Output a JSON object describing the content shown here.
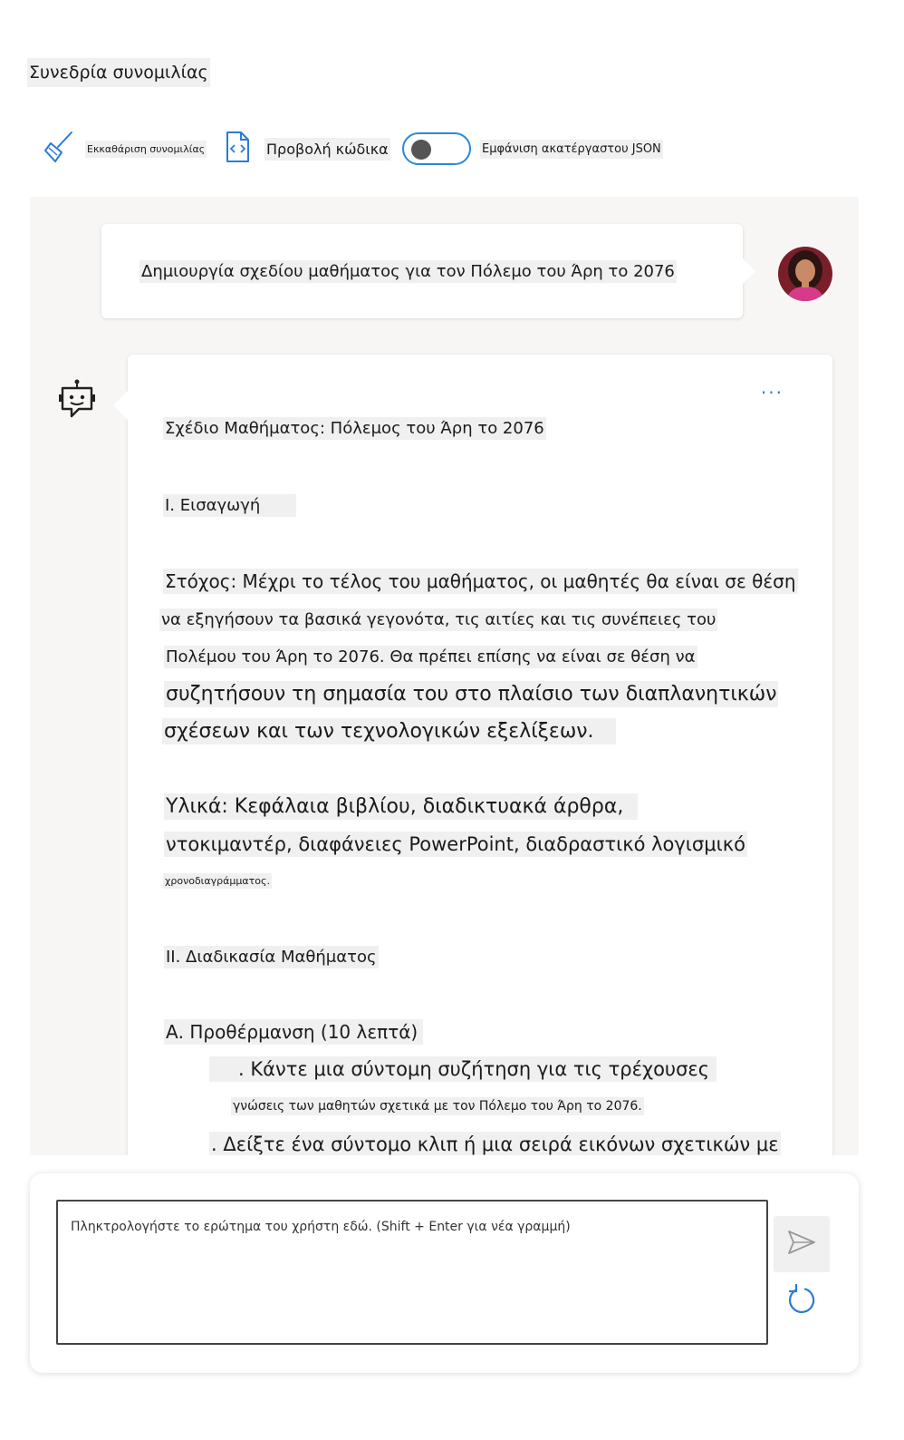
{
  "page_title": "Συνεδρία συνομιλίας",
  "toolbar": {
    "clear_label": "Εκκαθάριση συνομιλίας",
    "code_label": "Προβολή κώδικα",
    "raw_json_label": "Εμφάνιση ακατέργαστου JSON",
    "raw_json_enabled": false
  },
  "conversation": {
    "user_message": "Δημιουργία σχεδίου μαθήματος για τον Πόλεμο του Άρη το 2076",
    "assistant_lines": [
      "Σχέδιο Μαθήματος: Πόλεμος του Άρη το 2076",
      "I. Εισαγωγή",
      "Στόχος: Μέχρι το τέλος του μαθήματος, οι μαθητές θα είναι σε θέση",
      "να εξηγήσουν τα βασικά γεγονότα, τις αιτίες και τις συνέπειες του",
      "Πολέμου του Άρη το 2076. Θα πρέπει επίσης να είναι σε θέση να",
      "συζητήσουν τη σημασία του στο πλαίσιο των διαπλανητικών",
      "σχέσεων και των τεχνολογικών εξελίξεων.",
      "Υλικά: Κεφάλαια βιβλίου, διαδικτυακά άρθρα,",
      "ντοκιμαντέρ, διαφάνειες PowerPoint, διαδραστικό λογισμικό",
      "χρονοδιαγράμματος.",
      "II. Διαδικασία Μαθήματος",
      "Α. Προθέρμανση (10 λεπτά)",
      ". Κάντε μια σύντομη συζήτηση για τις τρέχουσες",
      "γνώσεις των μαθητών σχετικά με τον Πόλεμο του Άρη το 2076.",
      ". Δείξτε ένα σύντομο κλιπ ή μια σειρά εικόνων σχετικών με"
    ]
  },
  "input": {
    "placeholder": "Πληκτρολογήστε το ερώτημα του χρήστη εδώ. (Shift + Enter για νέα γραμμή)",
    "value": ""
  },
  "icons": {
    "clear": "broom-icon",
    "code": "code-file-icon",
    "assistant": "bot-icon",
    "send": "send-icon",
    "reset": "refresh-icon",
    "more": "ellipsis-icon"
  },
  "colors": {
    "accent": "#2b88d8",
    "chat_background": "#f7f6f5",
    "highlight": "#f0f0f0"
  }
}
